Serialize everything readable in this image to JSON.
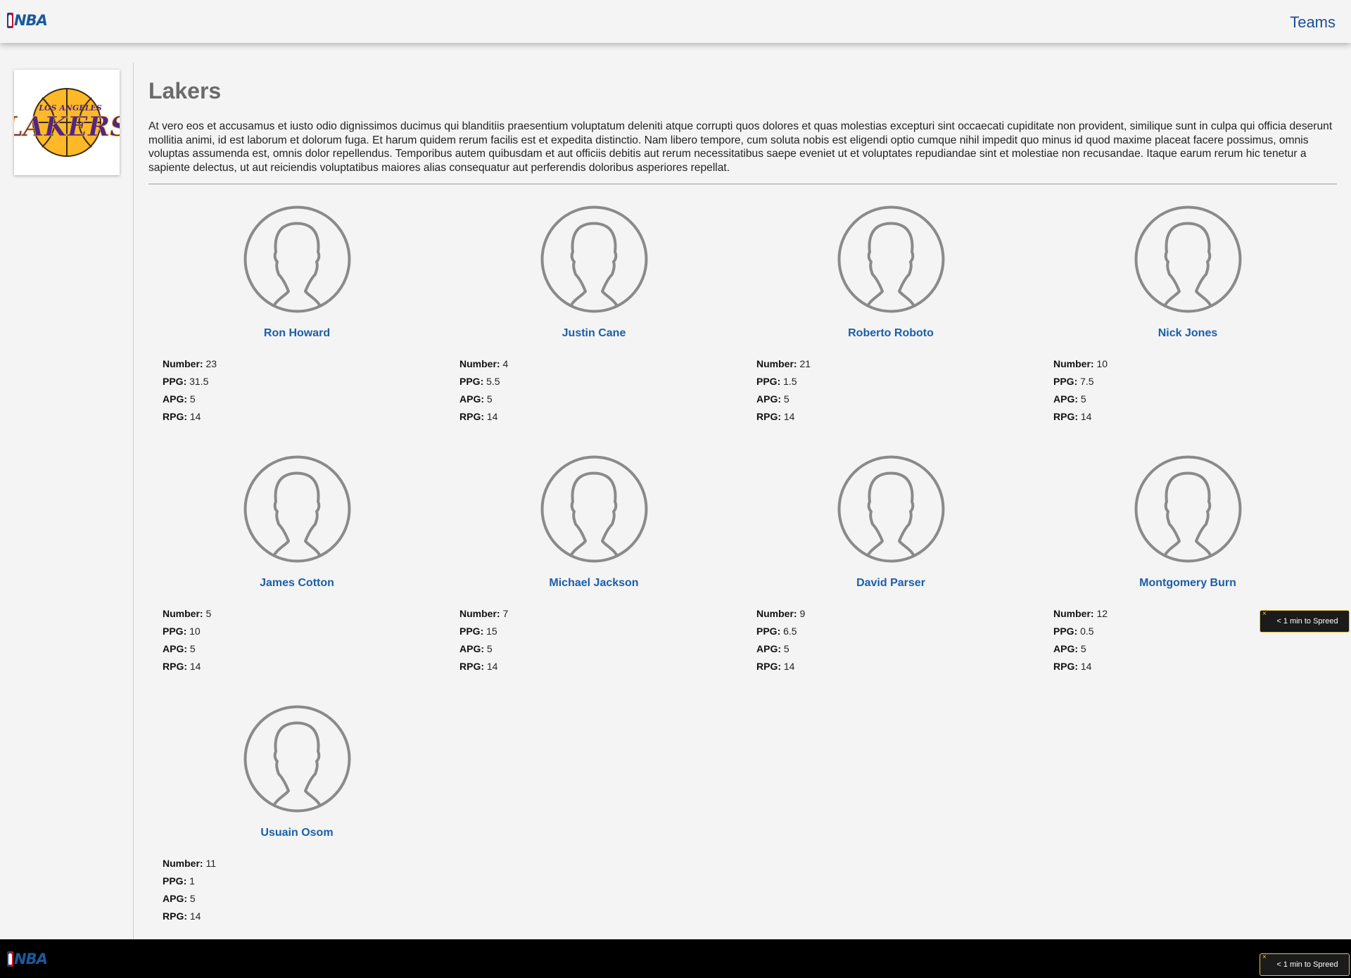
{
  "header": {
    "brand": "NBA",
    "nav_label": "Teams"
  },
  "team": {
    "name": "Lakers",
    "logo_text_top": "LOS ANGELES",
    "logo_text_main": "LAKERS",
    "description": "At vero eos et accusamus et iusto odio dignissimos ducimus qui blanditiis praesentium voluptatum deleniti atque corrupti quos dolores et quas molestias excepturi sint occaecati cupiditate non provident, similique sunt in culpa qui officia deserunt mollitia animi, id est laborum et dolorum fuga. Et harum quidem rerum facilis est et expedita distinctio. Nam libero tempore, cum soluta nobis est eligendi optio cumque nihil impedit quo minus id quod maxime placeat facere possimus, omnis voluptas assumenda est, omnis dolor repellendus. Temporibus autem quibusdam et aut officiis debitis aut rerum necessitatibus saepe eveniet ut et voluptates repudiandae sint et molestiae non recusandae. Itaque earum rerum hic tenetur a sapiente delectus, ut aut reiciendis voluptatibus maiores alias consequatur aut perferendis doloribus asperiores repellat."
  },
  "stat_labels": {
    "number": "Number:",
    "ppg": "PPG:",
    "apg": "APG:",
    "rpg": "RPG:"
  },
  "players": [
    {
      "name": "Ron Howard",
      "number": "23",
      "ppg": "31.5",
      "apg": "5",
      "rpg": "14"
    },
    {
      "name": "Justin Cane",
      "number": "4",
      "ppg": "5.5",
      "apg": "5",
      "rpg": "14"
    },
    {
      "name": "Roberto Roboto",
      "number": "21",
      "ppg": "1.5",
      "apg": "5",
      "rpg": "14"
    },
    {
      "name": "Nick Jones",
      "number": "10",
      "ppg": "7.5",
      "apg": "5",
      "rpg": "14"
    },
    {
      "name": "James Cotton",
      "number": "5",
      "ppg": "10",
      "apg": "5",
      "rpg": "14"
    },
    {
      "name": "Michael Jackson",
      "number": "7",
      "ppg": "15",
      "apg": "5",
      "rpg": "14"
    },
    {
      "name": "David Parser",
      "number": "9",
      "ppg": "6.5",
      "apg": "5",
      "rpg": "14"
    },
    {
      "name": "Montgomery Burn",
      "number": "12",
      "ppg": "0.5",
      "apg": "5",
      "rpg": "14"
    },
    {
      "name": "Usuain Osom",
      "number": "11",
      "ppg": "1",
      "apg": "5",
      "rpg": "14"
    }
  ],
  "footer": {
    "brand": "NBA"
  },
  "spreed": {
    "label": "< 1 min to Spreed",
    "close": "×"
  },
  "colors": {
    "accent": "#1a5fa8",
    "avatar_stroke": "#8a8a8a",
    "badge_border": "#e3c343"
  }
}
